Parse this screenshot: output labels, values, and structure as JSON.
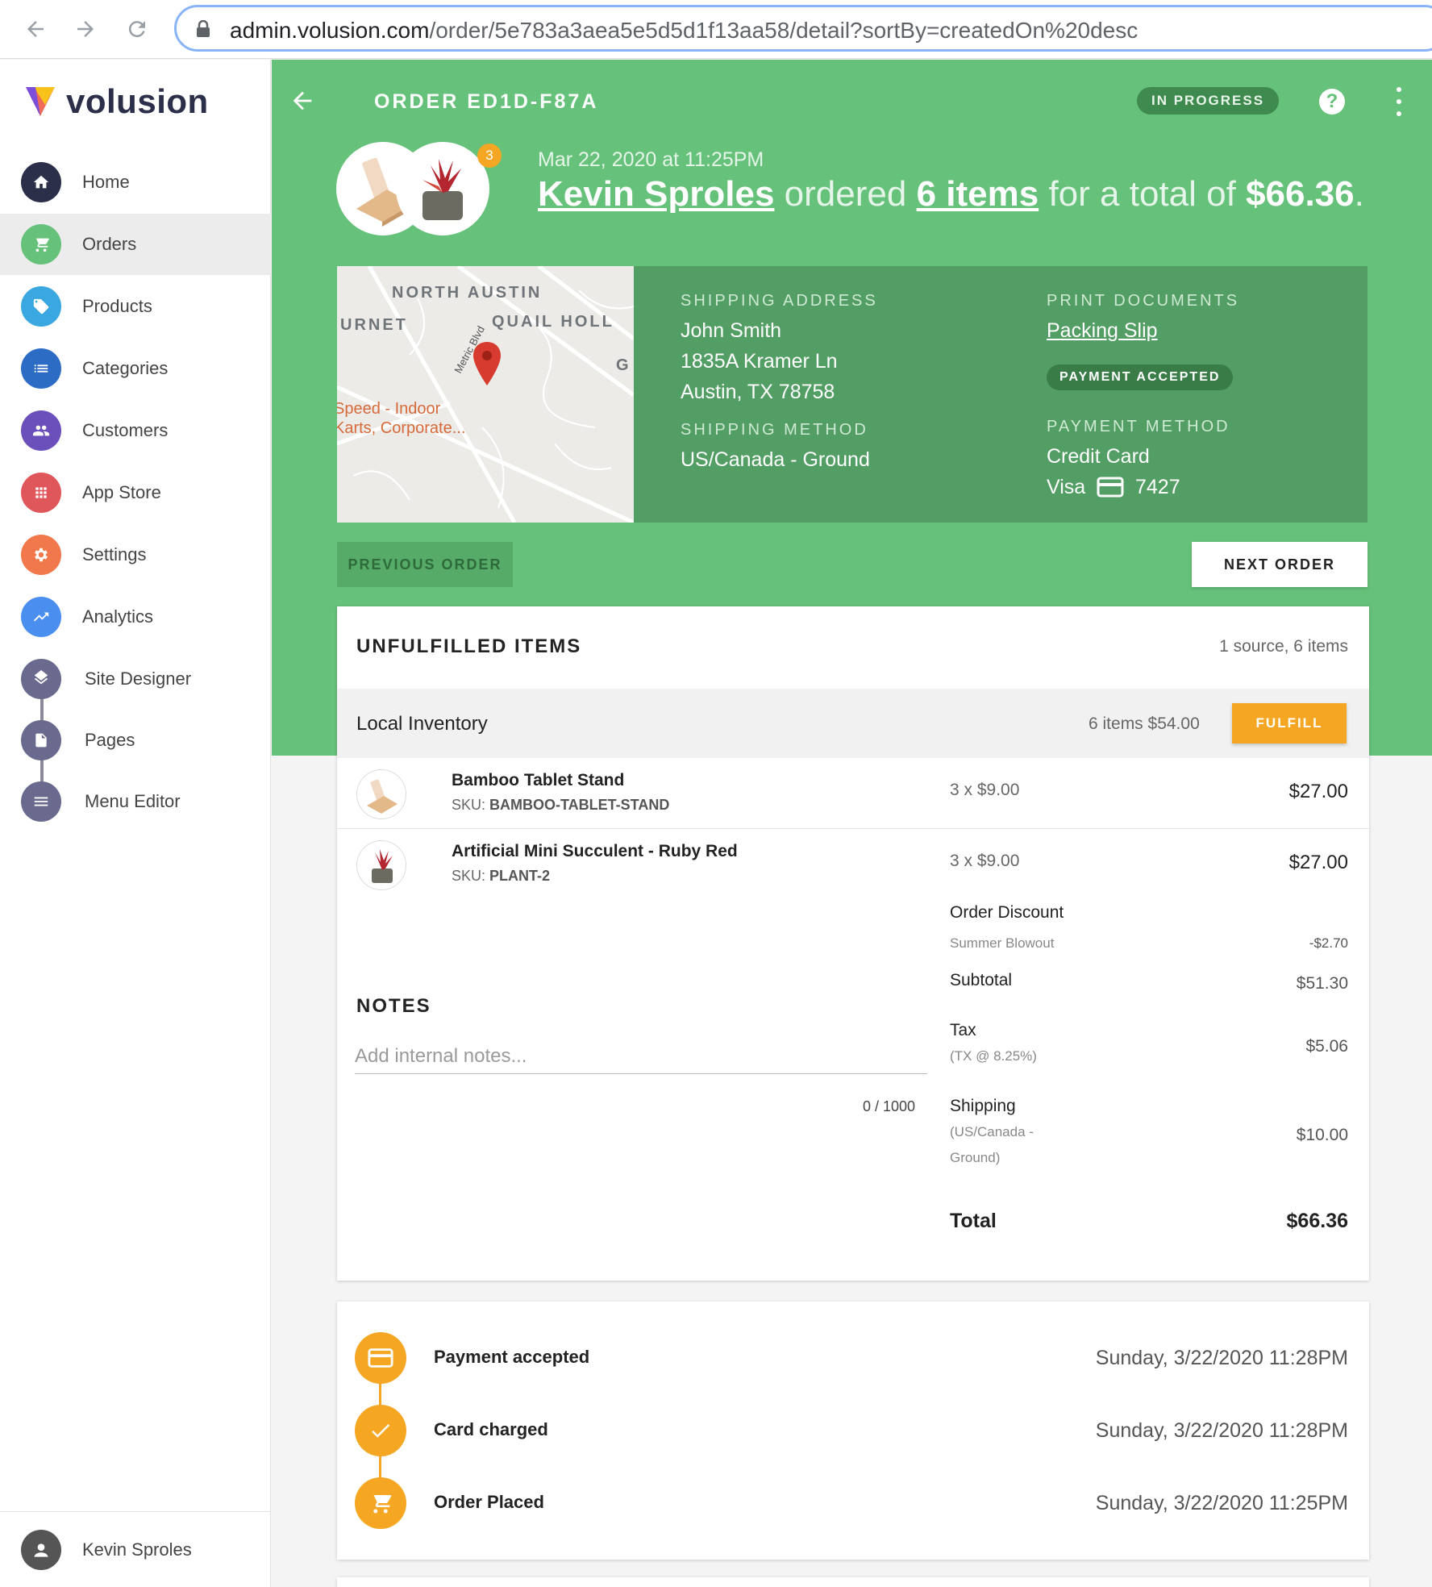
{
  "browser": {
    "url_domain": "admin.volusion.com",
    "url_path": "/order/5e783a3aea5e5d5d1f13aa58/detail?sortBy=createdOn%20desc"
  },
  "sidebar": {
    "brand": "volusion",
    "items": [
      {
        "label": "Home",
        "icon": "home-icon",
        "color": "#2b2f4a"
      },
      {
        "label": "Orders",
        "icon": "cart-icon",
        "color": "#66c17a"
      },
      {
        "label": "Products",
        "icon": "tag-icon",
        "color": "#3aa7e0"
      },
      {
        "label": "Categories",
        "icon": "list-icon",
        "color": "#2d6cc4"
      },
      {
        "label": "Customers",
        "icon": "people-icon",
        "color": "#6b4fbb"
      },
      {
        "label": "App Store",
        "icon": "grid-icon",
        "color": "#e0575b"
      },
      {
        "label": "Settings",
        "icon": "gear-icon",
        "color": "#f0784a"
      },
      {
        "label": "Analytics",
        "icon": "trend-icon",
        "color": "#4a8ff0"
      },
      {
        "label": "Site Designer",
        "icon": "layers-icon",
        "color": "#6a6a8e"
      },
      {
        "label": "Pages",
        "icon": "page-icon",
        "color": "#6a6a8e"
      },
      {
        "label": "Menu Editor",
        "icon": "menu-icon",
        "color": "#6a6a8e"
      }
    ],
    "user": "Kevin Sproles"
  },
  "header": {
    "order_title": "ORDER ED1D-F87A",
    "status": "IN PROGRESS",
    "item_count_badge": "3",
    "date": "Mar 22, 2020 at 11:25PM",
    "customer": "Kevin Sproles",
    "ordered_word": "ordered",
    "items_link": "6 items",
    "for_total": "for a total of",
    "total": "$66.36",
    "period": "."
  },
  "map": {
    "labels": [
      "NORTH AUSTIN",
      "URNET",
      "QUAIL HOLL",
      "G"
    ],
    "road": "Metric Blvd",
    "poi_line1": "Speed - Indoor",
    "poi_line2": "Karts, Corporate..."
  },
  "shipping": {
    "address_label": "SHIPPING ADDRESS",
    "name": "John Smith",
    "street": "1835A Kramer Ln",
    "city": "Austin, TX 78758",
    "method_label": "SHIPPING METHOD",
    "method": "US/Canada - Ground"
  },
  "documents": {
    "label": "PRINT DOCUMENTS",
    "packing_slip": "Packing Slip",
    "payment_status": "PAYMENT ACCEPTED",
    "payment_method_label": "PAYMENT METHOD",
    "payment_method": "Credit Card",
    "card_brand": "Visa",
    "card_last4": "7427"
  },
  "nav_buttons": {
    "previous": "PREVIOUS ORDER",
    "next": "NEXT ORDER"
  },
  "unfulfilled": {
    "title": "UNFULFILLED ITEMS",
    "meta": "1 source, 6 items",
    "source_name": "Local Inventory",
    "source_meta": "6 items $54.00",
    "fulfill": "FULFILL",
    "items": [
      {
        "name": "Bamboo Tablet Stand",
        "sku_label": "SKU:",
        "sku": "BAMBOO-TABLET-STAND",
        "qty": "3 x $9.00",
        "price": "$27.00"
      },
      {
        "name": "Artificial Mini Succulent - Ruby Red",
        "sku_label": "SKU:",
        "sku": "PLANT-2",
        "qty": "3 x $9.00",
        "price": "$27.00"
      }
    ]
  },
  "summary": {
    "discount_label": "Order Discount",
    "discount_name": "Summer Blowout",
    "discount_value": "-$2.70",
    "subtotal_label": "Subtotal",
    "subtotal_value": "$51.30",
    "tax_label": "Tax",
    "tax_sub": "(TX @ 8.25%)",
    "tax_value": "$5.06",
    "shipping_label": "Shipping",
    "shipping_sub1": "(US/Canada -",
    "shipping_sub2": "Ground)",
    "shipping_value": "$10.00",
    "total_label": "Total",
    "total_value": "$66.36"
  },
  "notes": {
    "title": "NOTES",
    "placeholder": "Add internal notes...",
    "count": "0 / 1000"
  },
  "timeline": [
    {
      "label": "Payment accepted",
      "date": "Sunday, 3/22/2020 11:28PM",
      "icon": "credit-card-icon"
    },
    {
      "label": "Card charged",
      "date": "Sunday, 3/22/2020 11:28PM",
      "icon": "check-icon"
    },
    {
      "label": "Order Placed",
      "date": "Sunday, 3/22/2020 11:25PM",
      "icon": "cart-icon"
    }
  ]
}
